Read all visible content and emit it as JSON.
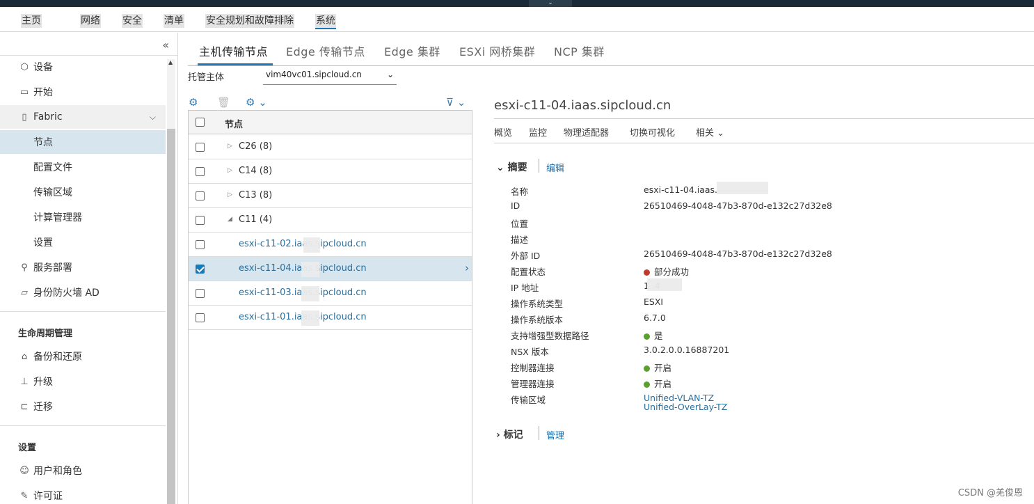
{
  "top_nav": {
    "items": [
      "主页",
      "网络",
      "安全",
      "清单",
      "安全规划和故障排除",
      "系统"
    ],
    "active": "系统"
  },
  "sidebar": {
    "collapse_icon": "«",
    "items": [
      {
        "label": "设备",
        "icon": "cube-icon"
      },
      {
        "label": "开始",
        "icon": "monitor-icon"
      },
      {
        "label": "Fabric",
        "icon": "document-icon"
      },
      {
        "label": "节点"
      },
      {
        "label": "配置文件"
      },
      {
        "label": "传输区域"
      },
      {
        "label": "计算管理器"
      },
      {
        "label": "设置"
      },
      {
        "label": "服务部署",
        "icon": "deploy-icon"
      },
      {
        "label": "身份防火墙 AD",
        "icon": "folder-icon"
      }
    ],
    "section_lifecycle": "生命周期管理",
    "lifecycle_items": [
      {
        "label": "备份和还原",
        "icon": "backup-icon"
      },
      {
        "label": "升级",
        "icon": "upgrade-icon"
      },
      {
        "label": "迁移",
        "icon": "migrate-icon"
      }
    ],
    "section_settings": "设置",
    "settings_items": [
      {
        "label": "用户和角色",
        "icon": "users-icon"
      },
      {
        "label": "许可证",
        "icon": "license-icon"
      }
    ]
  },
  "tabs": [
    "主机传输节点",
    "Edge 传输节点",
    "Edge 集群",
    "ESXi 网桥集群",
    "NCP 集群"
  ],
  "host": {
    "label": "托管主体",
    "value": "vim40vc01.sipcloud.cn"
  },
  "grid": {
    "header": "节点",
    "rows": [
      {
        "text": "C26 (8)",
        "type": "group",
        "expanded": false
      },
      {
        "text": "C14 (8)",
        "type": "group",
        "expanded": false
      },
      {
        "text": "C13 (8)",
        "type": "group",
        "expanded": false
      },
      {
        "text": "C11 (4)",
        "type": "group",
        "expanded": true
      },
      {
        "text": "esxi-c11-02.iaas.sipcloud.cn",
        "type": "host"
      },
      {
        "text": "esxi-c11-04.iaas.sipcloud.cn",
        "type": "host",
        "selected": true
      },
      {
        "text": "esxi-c11-03.iaas.sipcloud.cn",
        "type": "host"
      },
      {
        "text": "esxi-c11-01.iaas.sipcloud.cn",
        "type": "host"
      }
    ]
  },
  "detail": {
    "title": "esxi-c11-04.iaas.sipcloud.cn",
    "subtabs": [
      "概览",
      "监控",
      "物理适配器",
      "切换可视化",
      "相关"
    ],
    "summary_head": "摘要",
    "summary_edit": "编辑",
    "fields": [
      {
        "k": "名称",
        "v": "esxi-c11-04.iaas."
      },
      {
        "k": "ID",
        "v": "26510469-4048-47b3-870d-e132c27d32e8"
      },
      {
        "k": "位置",
        "v": ""
      },
      {
        "k": "描述",
        "v": ""
      },
      {
        "k": "外部 ID",
        "v": "26510469-4048-47b3-870d-e132c27d32e8"
      },
      {
        "k": "配置状态",
        "v": "部分成功",
        "status": "red"
      },
      {
        "k": "IP 地址",
        "v": "1          .4"
      },
      {
        "k": "操作系统类型",
        "v": "ESXI"
      },
      {
        "k": "操作系统版本",
        "v": "6.7.0"
      },
      {
        "k": "支持增强型数据路径",
        "v": "是",
        "status": "green"
      },
      {
        "k": "NSX 版本",
        "v": "3.0.2.0.0.16887201"
      },
      {
        "k": "控制器连接",
        "v": "开启",
        "status": "green"
      },
      {
        "k": "管理器连接",
        "v": "开启",
        "status": "green"
      },
      {
        "k": "传输区域",
        "v": "Unified-VLAN-TZ",
        "v2": "Unified-OverLay-TZ"
      }
    ],
    "tags_head": "标记",
    "tags_manage": "管理"
  },
  "watermark": "CSDN @羌俊恩"
}
